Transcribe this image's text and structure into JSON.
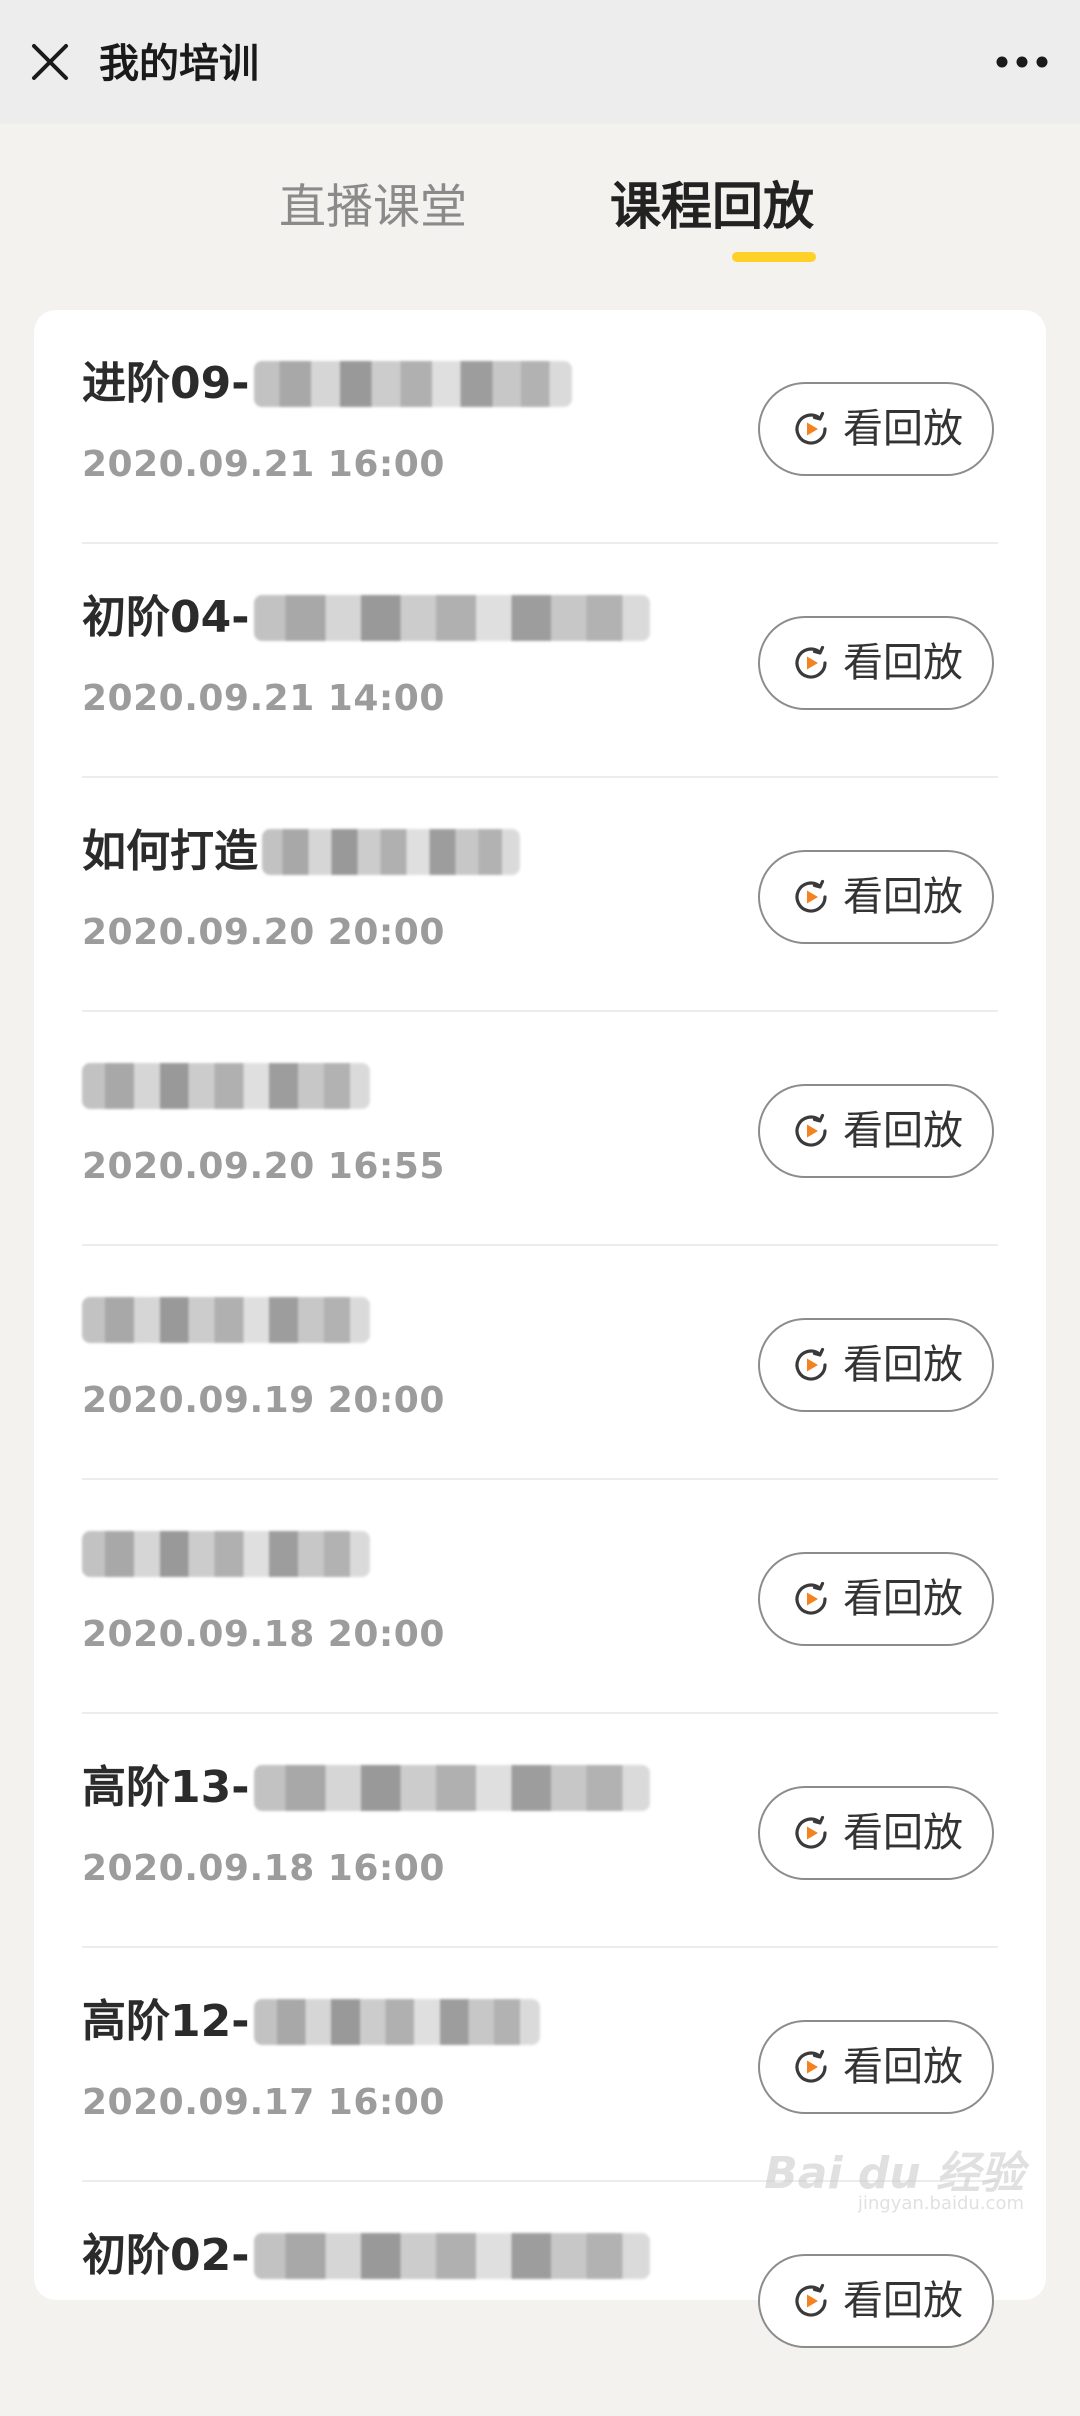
{
  "header": {
    "title": "我的培训",
    "close_icon": "close-icon",
    "more_icon": "more-icon"
  },
  "tabs": [
    {
      "label": "直播课堂",
      "active": false
    },
    {
      "label": "课程回放",
      "active": true
    }
  ],
  "accent_color": "#ffd128",
  "replay_icon_color": "#f58220",
  "items": [
    {
      "title": "进阶09-",
      "date": "2020.09.21 16:00",
      "button": "看回放"
    },
    {
      "title": "初阶04-",
      "date": "2020.09.21 14:00",
      "button": "看回放"
    },
    {
      "title": "如何打造",
      "date": "2020.09.20 20:00",
      "button": "看回放"
    },
    {
      "title": "",
      "date": "2020.09.20 16:55",
      "button": "看回放"
    },
    {
      "title": "",
      "date": "2020.09.19 20:00",
      "button": "看回放"
    },
    {
      "title": "",
      "date": "2020.09.18 20:00",
      "button": "看回放"
    },
    {
      "title": "高阶13-",
      "date": "2020.09.18 16:00",
      "button": "看回放"
    },
    {
      "title": "高阶12-",
      "date": "2020.09.17 16:00",
      "button": "看回放"
    },
    {
      "title": "初阶02-",
      "date": "",
      "button": "看回放"
    }
  ],
  "watermark": {
    "main": "Bai du 经验",
    "sub": "jingyan.baidu.com"
  }
}
